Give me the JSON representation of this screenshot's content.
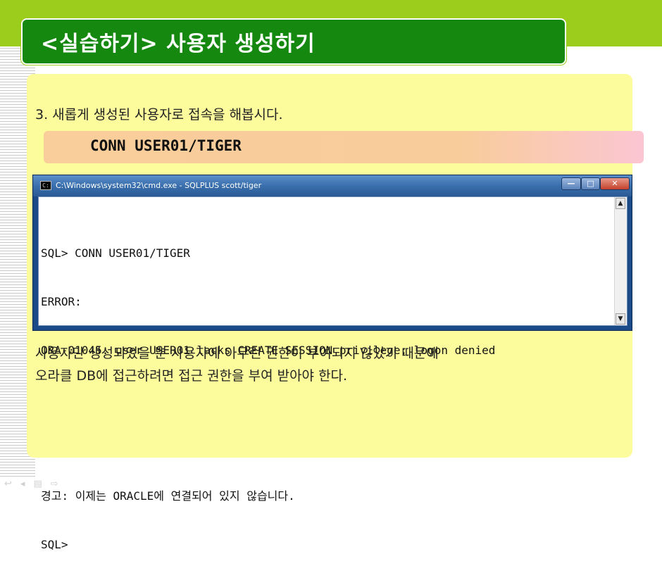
{
  "title": "<실습하기> 사용자 생성하기",
  "step": "3. 새롭게 생성된 사용자로 접속을 해봅시다.",
  "command": "CONN USER01/TIGER",
  "cmd_window": {
    "title": "C:\\Windows\\system32\\cmd.exe - SQLPLUS  scott/tiger",
    "buttons": {
      "minimize": "—",
      "maximize": "□",
      "close": "✕"
    },
    "lines": [
      "SQL> CONN USER01/TIGER",
      "ERROR:",
      "ORA-01045: user USER01 lacks CREATE SESSION privilege; logon denied",
      "",
      "",
      "경고: 이제는 ORACLE에 연결되어 있지 않습니다.",
      "SQL>"
    ]
  },
  "description": [
    "사용자만 생성되었을 뿐 사용자에 아무런 권한이 부여되지 않았기 때문에",
    "오라클 DB에 접근하려면 접근 권한을 부여 받아야 한다."
  ],
  "footer_nav": {
    "back": "↩",
    "prev": "◂",
    "menu": "▤",
    "next": "⇨"
  },
  "colors": {
    "title_bg": "#15890f",
    "top_band": "#9ccc1c",
    "content_bg": "#fcfc9c",
    "command_bar": "#f9ce9a"
  }
}
